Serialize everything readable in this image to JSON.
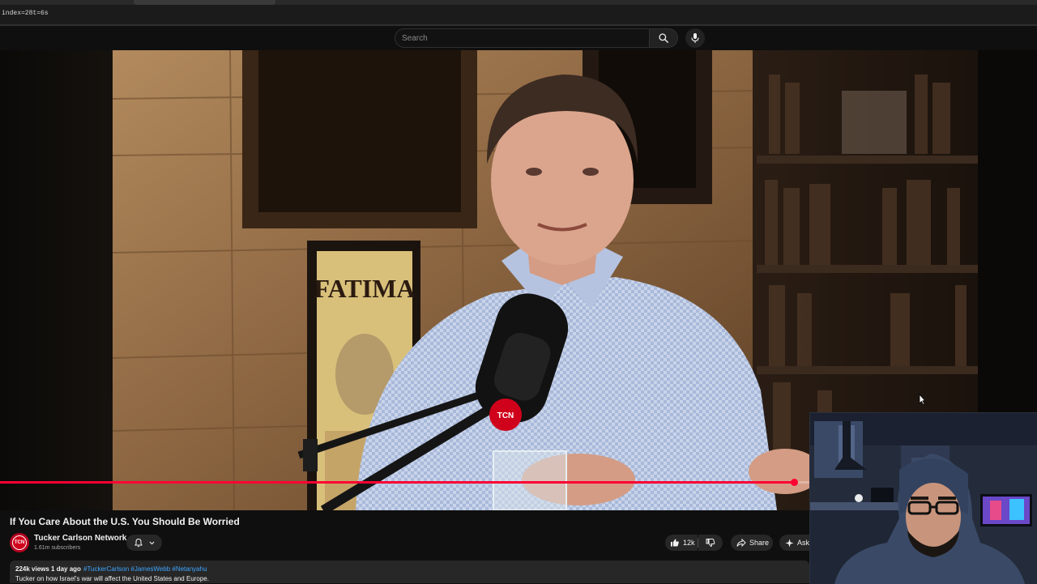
{
  "browser": {
    "url_fragment": "index=28t=6s"
  },
  "header": {
    "search_placeholder": "Search",
    "search_icon": "search-icon",
    "mic_icon": "microphone-icon"
  },
  "player": {
    "progress": 0.766,
    "mic_badge": "TCN",
    "poster_text": "FATIMA"
  },
  "video": {
    "title": "If You Care About the U.S. You Should Be Worried",
    "channel": {
      "avatar_text": "TCN",
      "name": "Tucker Carlson Network",
      "subscribers": "1.61m subscribers"
    },
    "actions": {
      "like_count": "12k",
      "share_label": "Share",
      "ask_label": "Ask"
    },
    "description": {
      "views_date": "224k views  1 day ago",
      "hashtags": "#TuckerCarlson #JamesWebb #Netanyahu",
      "text": "Tucker on how Israel's war will affect the United States and Europe."
    }
  },
  "colors": {
    "accent_red": "#ff0033",
    "link_blue": "#3ea6ff",
    "background": "#0f0f0f"
  }
}
